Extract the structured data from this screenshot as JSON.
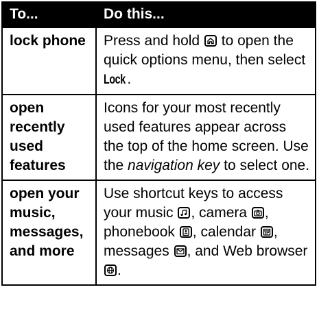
{
  "header": {
    "col1": "To...",
    "col2": "Do this..."
  },
  "rows": [
    {
      "action": "lock phone",
      "p1": "Press and hold",
      "p2": "to open the quick options menu, then select",
      "menu": "Lock",
      "p3": "."
    },
    {
      "action": "open recently used features",
      "p1": "Icons for your most recently used features appear across the top of the home screen. Use the",
      "em": "navigation key",
      "p2": "to select one."
    },
    {
      "action": "open your music, messages, and more",
      "p1": "Use shortcut keys to access your music",
      "p2": ", camera",
      "p3": ", phonebook",
      "p4": ", calendar",
      "p5": ", messages",
      "p6": ", and Web browser",
      "p7": "."
    }
  ],
  "icons": [
    "home-key-icon",
    "music-key-icon",
    "camera-key-icon",
    "phonebook-key-icon",
    "calendar-key-icon",
    "messages-key-icon",
    "web-browser-key-icon"
  ]
}
